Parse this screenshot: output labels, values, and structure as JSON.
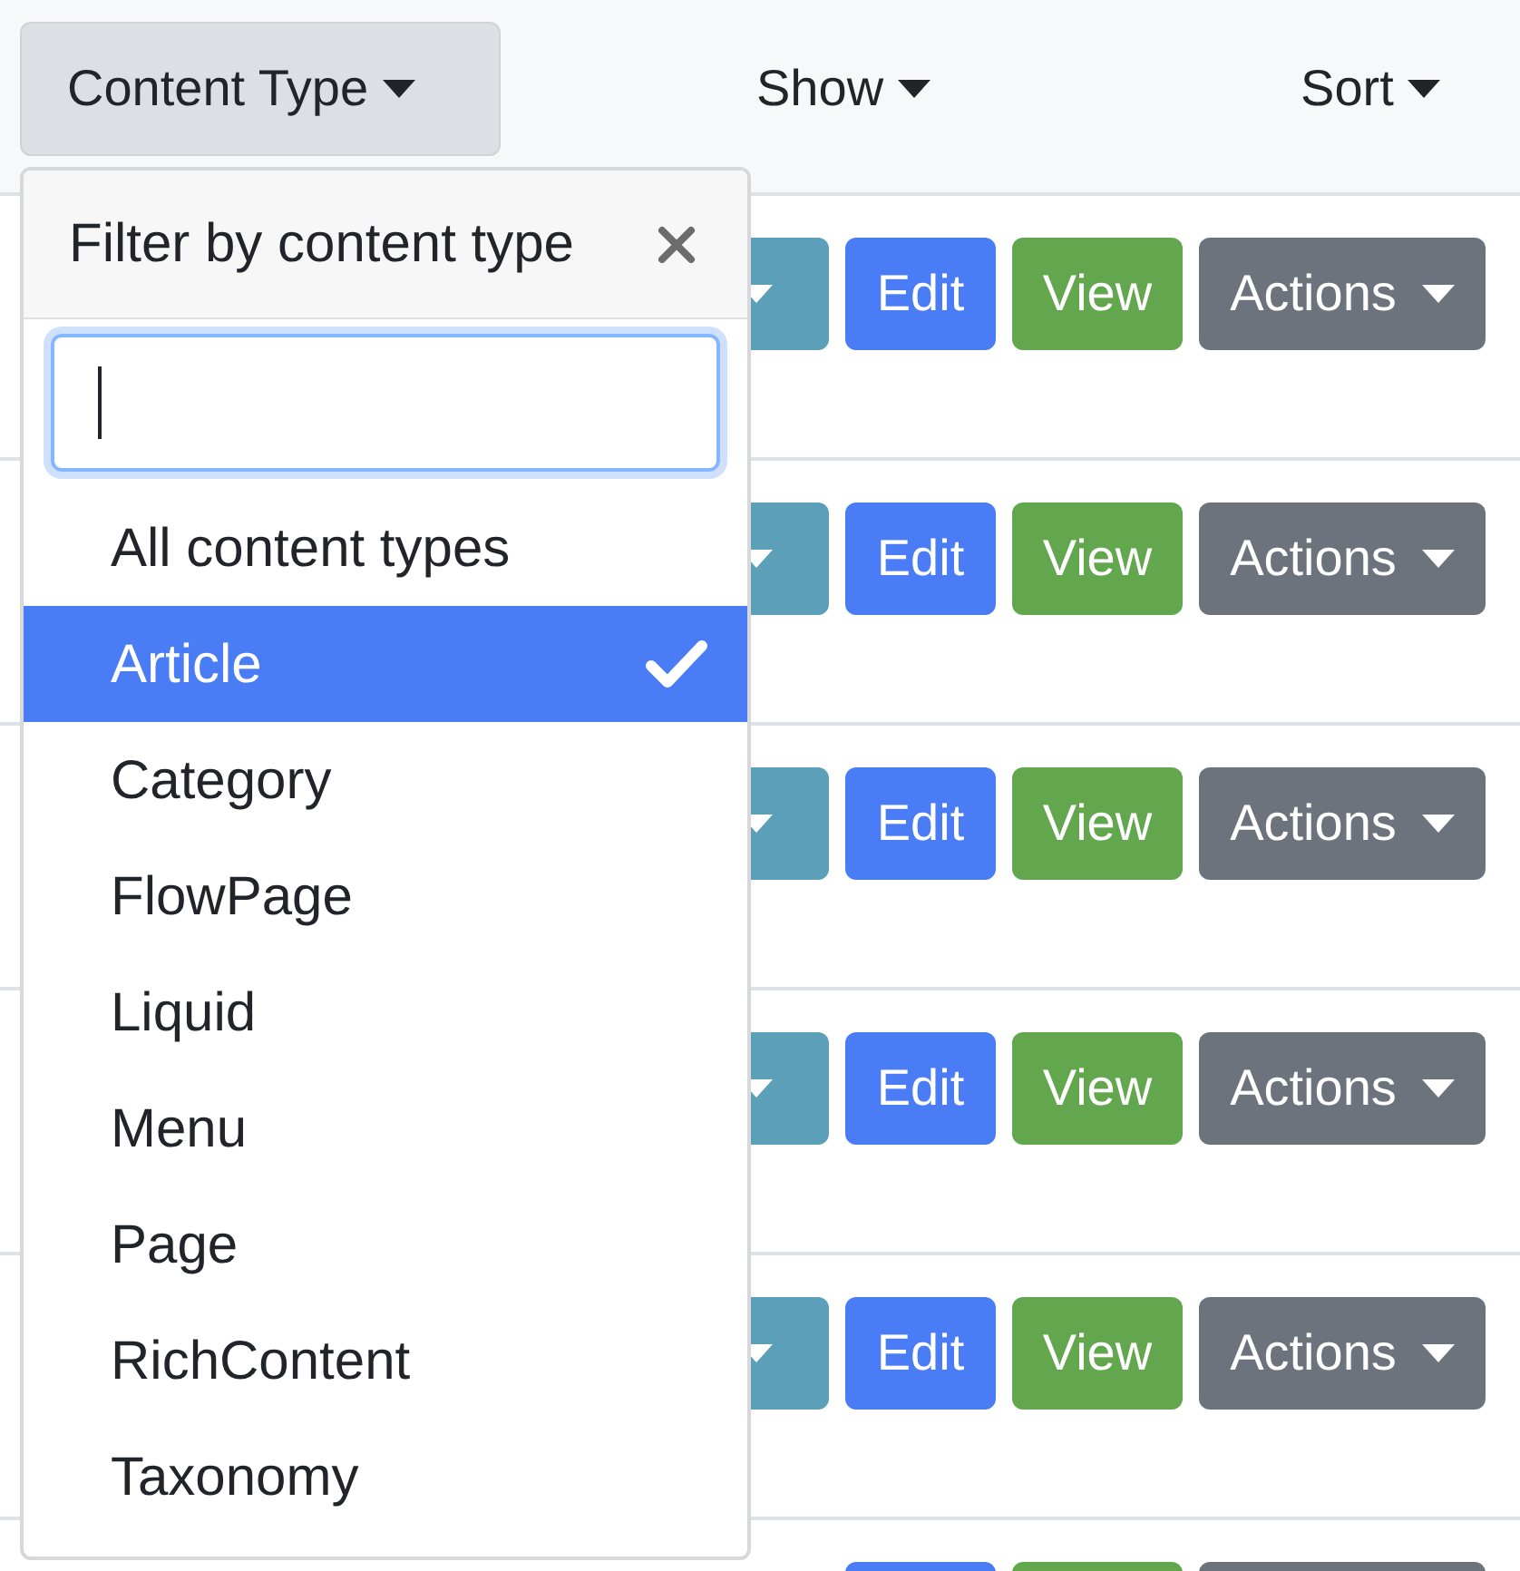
{
  "toolbar": [
    {
      "label": "Content Type",
      "selected": true
    },
    {
      "label": "Show",
      "selected": false
    },
    {
      "label": "Sort",
      "selected": false
    }
  ],
  "filter_menu": {
    "title": "Filter by content type",
    "search": {
      "focused": true
    },
    "items": [
      {
        "label": "All content types",
        "selected": false
      },
      {
        "label": "Article",
        "selected": true
      },
      {
        "label": "Category",
        "selected": false
      },
      {
        "label": "FlowPage",
        "selected": false
      },
      {
        "label": "Liquid",
        "selected": false
      },
      {
        "label": "Menu",
        "selected": false
      },
      {
        "label": "Page",
        "selected": false
      },
      {
        "label": "RichContent",
        "selected": false
      },
      {
        "label": "Taxonomy",
        "selected": false
      }
    ]
  },
  "rows": [
    {
      "buttons": [
        {
          "kind": "split",
          "caret": true
        },
        {
          "kind": "edit",
          "label": "Edit",
          "caret": false
        },
        {
          "kind": "view",
          "label": "View",
          "caret": false
        },
        {
          "kind": "actions",
          "label": "Actions",
          "caret": true
        }
      ]
    },
    {
      "buttons": [
        {
          "kind": "split",
          "caret": true
        },
        {
          "kind": "edit",
          "label": "Edit",
          "caret": false
        },
        {
          "kind": "view",
          "label": "View",
          "caret": false
        },
        {
          "kind": "actions",
          "label": "Actions",
          "caret": true
        }
      ]
    },
    {
      "buttons": [
        {
          "kind": "split",
          "caret": true
        },
        {
          "kind": "edit",
          "label": "Edit",
          "caret": false
        },
        {
          "kind": "view",
          "label": "View",
          "caret": false
        },
        {
          "kind": "actions",
          "label": "Actions",
          "caret": true
        }
      ]
    },
    {
      "buttons": [
        {
          "kind": "split",
          "caret": true
        },
        {
          "kind": "edit",
          "label": "Edit",
          "caret": false
        },
        {
          "kind": "view",
          "label": "View",
          "caret": false
        },
        {
          "kind": "actions",
          "label": "Actions",
          "caret": true
        }
      ]
    },
    {
      "buttons": [
        {
          "kind": "split",
          "caret": true
        },
        {
          "kind": "edit",
          "label": "Edit",
          "caret": false
        },
        {
          "kind": "view",
          "label": "View",
          "caret": false
        },
        {
          "kind": "actions",
          "label": "Actions",
          "caret": true
        }
      ]
    },
    {
      "buttons": [
        {
          "kind": "edit"
        },
        {
          "kind": "view"
        },
        {
          "kind": "actions"
        }
      ]
    }
  ]
}
